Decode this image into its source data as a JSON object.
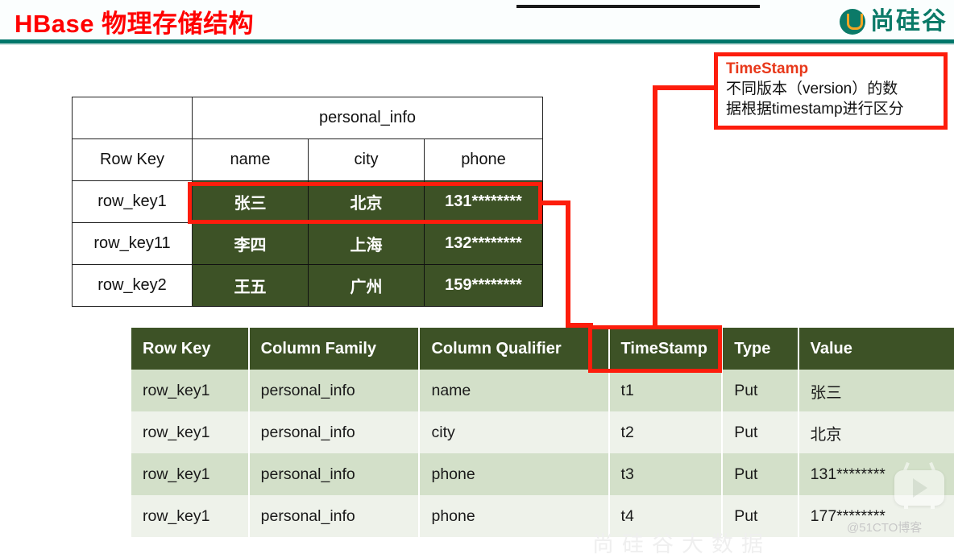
{
  "header": {
    "title": "HBase 物理存储结构",
    "logo_text": "尚硅谷",
    "logo_mark": "u-circle-icon",
    "title_color": "#ff0000",
    "accent_color": "#00766a"
  },
  "logical_table": {
    "column_family_label": "personal_info",
    "headers": [
      "Row Key",
      "name",
      "city",
      "phone"
    ],
    "rows": [
      {
        "row_key": "row_key1",
        "name": "张三",
        "city": "北京",
        "phone": "131********"
      },
      {
        "row_key": "row_key11",
        "name": "李四",
        "city": "上海",
        "phone": "132********"
      },
      {
        "row_key": "row_key2",
        "name": "王五",
        "city": "广州",
        "phone": "159********"
      }
    ],
    "highlight_row_index": 0,
    "cell_bg": "#3d5226"
  },
  "physical_table": {
    "headers": [
      "Row Key",
      "Column Family",
      "Column Qualifier",
      "TimeStamp",
      "Type",
      "Value"
    ],
    "highlight_header": "TimeStamp",
    "rows": [
      {
        "row_key": "row_key1",
        "column_family": "personal_info",
        "column_qualifier": "name",
        "timestamp": "t1",
        "type": "Put",
        "value": "张三"
      },
      {
        "row_key": "row_key1",
        "column_family": "personal_info",
        "column_qualifier": "city",
        "timestamp": "t2",
        "type": "Put",
        "value": "北京"
      },
      {
        "row_key": "row_key1",
        "column_family": "personal_info",
        "column_qualifier": "phone",
        "timestamp": "t3",
        "type": "Put",
        "value": "131********"
      },
      {
        "row_key": "row_key1",
        "column_family": "personal_info",
        "column_qualifier": "phone",
        "timestamp": "t4",
        "type": "Put",
        "value": "177********"
      }
    ],
    "header_bg": "#3d5226",
    "row_bg_odd": "#d3e0c9",
    "row_bg_even": "#eef2ea"
  },
  "callout": {
    "title": "TimeStamp",
    "line1": "不同版本（version）的数",
    "line2": "据根据timestamp进行区分",
    "border_color": "#fd1d0c",
    "title_color": "#e8381a"
  },
  "watermarks": {
    "site": "@51CTO博客",
    "faint_bottom": "尚硅谷大数据",
    "play_button": "play-button-icon"
  }
}
